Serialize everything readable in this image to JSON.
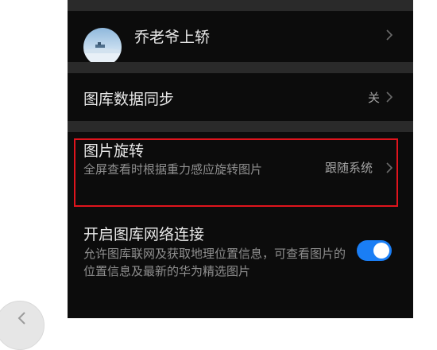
{
  "profile": {
    "name": "乔老爷上轿"
  },
  "settings": [
    {
      "title": "图库数据同步",
      "value": "关"
    },
    {
      "title": "图片旋转",
      "subtitle": "全屏查看时根据重力感应旋转图片",
      "value": "跟随系统"
    },
    {
      "title": "开启图库网络连接",
      "subtitle": "允许图库联网及获取地理位置信息，可查看图片的位置信息及最新的华为精选图片",
      "toggle_on": true
    }
  ],
  "colors": {
    "highlight": "#e0141d",
    "toggle": "#1a7ef5",
    "background": "#0c0c0c"
  },
  "icons": [
    "chevron-right-icon",
    "back-arrow-icon"
  ]
}
